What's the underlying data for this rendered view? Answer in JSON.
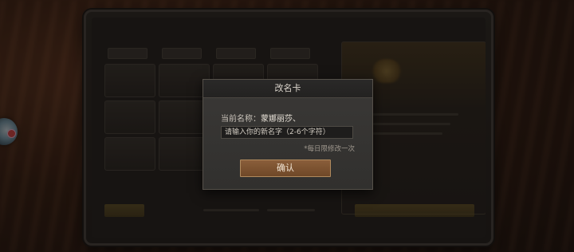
{
  "dialog": {
    "title": "改名卡",
    "current_name_label": "当前名称：",
    "current_name_value": "蒙娜丽莎、",
    "input_placeholder": "请输入你的新名字（2-6个字符）",
    "limit_note": "*每日限修改一次",
    "confirm_label": "确认"
  },
  "colors": {
    "confirm_button": "#7d5433",
    "dialog_bg": "#353331",
    "overlay": "#0c0a08"
  }
}
